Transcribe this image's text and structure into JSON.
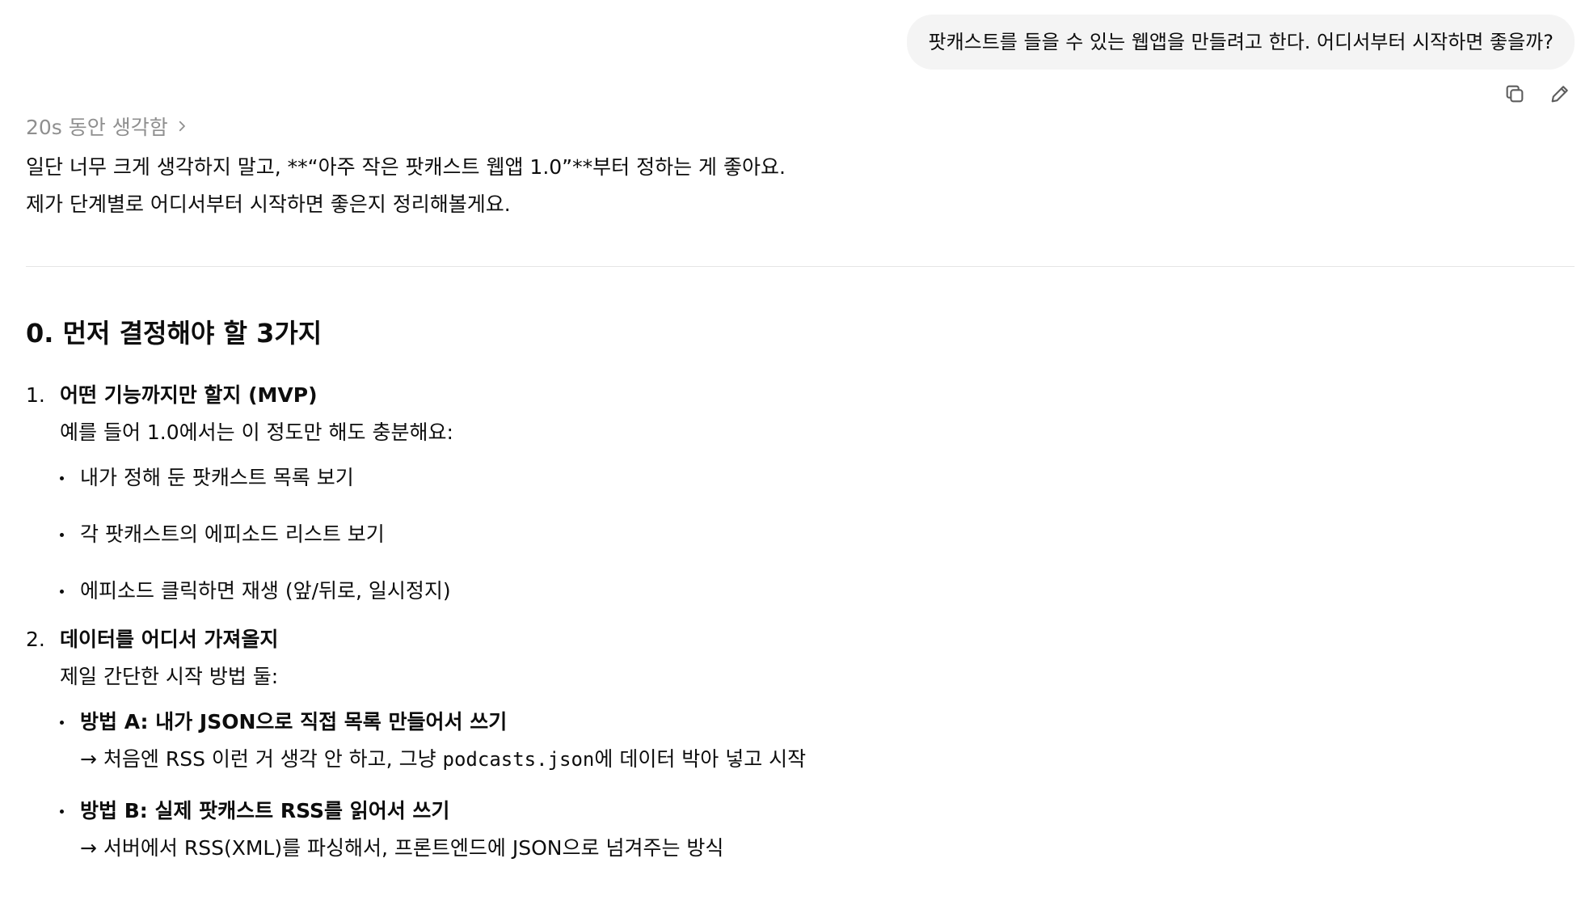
{
  "user_message": "팟캐스트를 들을 수 있는 웹앱을 만들려고 한다. 어디서부터 시작하면 좋을까?",
  "icons": {
    "copy": "copy-icon",
    "edit": "pencil-icon",
    "chevron": "chevron-right-icon"
  },
  "thinking_label": "20s 동안 생각함",
  "intro": {
    "line1": "일단 너무 크게 생각하지 말고, **“아주 작은 팟캐스트 웹앱 1.0”**부터 정하는 게 좋아요.",
    "line2": "제가 단계별로 어디서부터 시작하면 좋은지 정리해볼게요."
  },
  "section_title": "0. 먼저 결정해야 할 3가지",
  "items": [
    {
      "num": "1.",
      "title": "어떤 기능까지만 할지 (MVP)",
      "desc": "예를 들어 1.0에서는 이 정도만 해도 충분해요:",
      "bullets": [
        "내가 정해 둔 팟캐스트 목록 보기",
        "각 팟캐스트의 에피소드 리스트 보기",
        "에피소드 클릭하면 재생 (앞/뒤로, 일시정지)"
      ]
    },
    {
      "num": "2.",
      "title": "데이터를 어디서 가져올지",
      "desc": "제일 간단한 시작 방법 둘:",
      "options": [
        {
          "title": "방법 A: 내가 JSON으로 직접 목록 만들어서 쓰기",
          "detail_pre": "→ 처음엔 RSS 이런 거 생각 안 하고, 그냥 ",
          "detail_code": "podcasts.json",
          "detail_post": "에 데이터 박아 넣고 시작"
        },
        {
          "title": "방법 B: 실제 팟캐스트 RSS를 읽어서 쓰기",
          "detail": "→ 서버에서 RSS(XML)를 파싱해서, 프론트엔드에 JSON으로 넘겨주는 방식"
        }
      ]
    }
  ]
}
